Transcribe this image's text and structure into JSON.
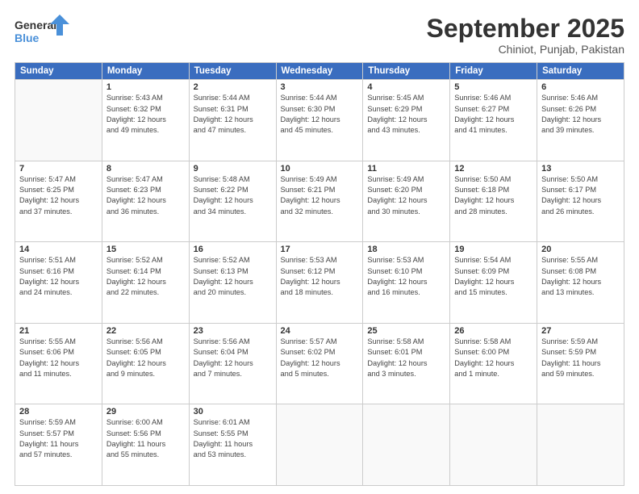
{
  "header": {
    "logo_line1": "General",
    "logo_line2": "Blue",
    "month": "September 2025",
    "location": "Chiniot, Punjab, Pakistan"
  },
  "days_of_week": [
    "Sunday",
    "Monday",
    "Tuesday",
    "Wednesday",
    "Thursday",
    "Friday",
    "Saturday"
  ],
  "weeks": [
    [
      {
        "num": "",
        "info": ""
      },
      {
        "num": "1",
        "info": "Sunrise: 5:43 AM\nSunset: 6:32 PM\nDaylight: 12 hours\nand 49 minutes."
      },
      {
        "num": "2",
        "info": "Sunrise: 5:44 AM\nSunset: 6:31 PM\nDaylight: 12 hours\nand 47 minutes."
      },
      {
        "num": "3",
        "info": "Sunrise: 5:44 AM\nSunset: 6:30 PM\nDaylight: 12 hours\nand 45 minutes."
      },
      {
        "num": "4",
        "info": "Sunrise: 5:45 AM\nSunset: 6:29 PM\nDaylight: 12 hours\nand 43 minutes."
      },
      {
        "num": "5",
        "info": "Sunrise: 5:46 AM\nSunset: 6:27 PM\nDaylight: 12 hours\nand 41 minutes."
      },
      {
        "num": "6",
        "info": "Sunrise: 5:46 AM\nSunset: 6:26 PM\nDaylight: 12 hours\nand 39 minutes."
      }
    ],
    [
      {
        "num": "7",
        "info": "Sunrise: 5:47 AM\nSunset: 6:25 PM\nDaylight: 12 hours\nand 37 minutes."
      },
      {
        "num": "8",
        "info": "Sunrise: 5:47 AM\nSunset: 6:23 PM\nDaylight: 12 hours\nand 36 minutes."
      },
      {
        "num": "9",
        "info": "Sunrise: 5:48 AM\nSunset: 6:22 PM\nDaylight: 12 hours\nand 34 minutes."
      },
      {
        "num": "10",
        "info": "Sunrise: 5:49 AM\nSunset: 6:21 PM\nDaylight: 12 hours\nand 32 minutes."
      },
      {
        "num": "11",
        "info": "Sunrise: 5:49 AM\nSunset: 6:20 PM\nDaylight: 12 hours\nand 30 minutes."
      },
      {
        "num": "12",
        "info": "Sunrise: 5:50 AM\nSunset: 6:18 PM\nDaylight: 12 hours\nand 28 minutes."
      },
      {
        "num": "13",
        "info": "Sunrise: 5:50 AM\nSunset: 6:17 PM\nDaylight: 12 hours\nand 26 minutes."
      }
    ],
    [
      {
        "num": "14",
        "info": "Sunrise: 5:51 AM\nSunset: 6:16 PM\nDaylight: 12 hours\nand 24 minutes."
      },
      {
        "num": "15",
        "info": "Sunrise: 5:52 AM\nSunset: 6:14 PM\nDaylight: 12 hours\nand 22 minutes."
      },
      {
        "num": "16",
        "info": "Sunrise: 5:52 AM\nSunset: 6:13 PM\nDaylight: 12 hours\nand 20 minutes."
      },
      {
        "num": "17",
        "info": "Sunrise: 5:53 AM\nSunset: 6:12 PM\nDaylight: 12 hours\nand 18 minutes."
      },
      {
        "num": "18",
        "info": "Sunrise: 5:53 AM\nSunset: 6:10 PM\nDaylight: 12 hours\nand 16 minutes."
      },
      {
        "num": "19",
        "info": "Sunrise: 5:54 AM\nSunset: 6:09 PM\nDaylight: 12 hours\nand 15 minutes."
      },
      {
        "num": "20",
        "info": "Sunrise: 5:55 AM\nSunset: 6:08 PM\nDaylight: 12 hours\nand 13 minutes."
      }
    ],
    [
      {
        "num": "21",
        "info": "Sunrise: 5:55 AM\nSunset: 6:06 PM\nDaylight: 12 hours\nand 11 minutes."
      },
      {
        "num": "22",
        "info": "Sunrise: 5:56 AM\nSunset: 6:05 PM\nDaylight: 12 hours\nand 9 minutes."
      },
      {
        "num": "23",
        "info": "Sunrise: 5:56 AM\nSunset: 6:04 PM\nDaylight: 12 hours\nand 7 minutes."
      },
      {
        "num": "24",
        "info": "Sunrise: 5:57 AM\nSunset: 6:02 PM\nDaylight: 12 hours\nand 5 minutes."
      },
      {
        "num": "25",
        "info": "Sunrise: 5:58 AM\nSunset: 6:01 PM\nDaylight: 12 hours\nand 3 minutes."
      },
      {
        "num": "26",
        "info": "Sunrise: 5:58 AM\nSunset: 6:00 PM\nDaylight: 12 hours\nand 1 minute."
      },
      {
        "num": "27",
        "info": "Sunrise: 5:59 AM\nSunset: 5:59 PM\nDaylight: 11 hours\nand 59 minutes."
      }
    ],
    [
      {
        "num": "28",
        "info": "Sunrise: 5:59 AM\nSunset: 5:57 PM\nDaylight: 11 hours\nand 57 minutes."
      },
      {
        "num": "29",
        "info": "Sunrise: 6:00 AM\nSunset: 5:56 PM\nDaylight: 11 hours\nand 55 minutes."
      },
      {
        "num": "30",
        "info": "Sunrise: 6:01 AM\nSunset: 5:55 PM\nDaylight: 11 hours\nand 53 minutes."
      },
      {
        "num": "",
        "info": ""
      },
      {
        "num": "",
        "info": ""
      },
      {
        "num": "",
        "info": ""
      },
      {
        "num": "",
        "info": ""
      }
    ]
  ]
}
